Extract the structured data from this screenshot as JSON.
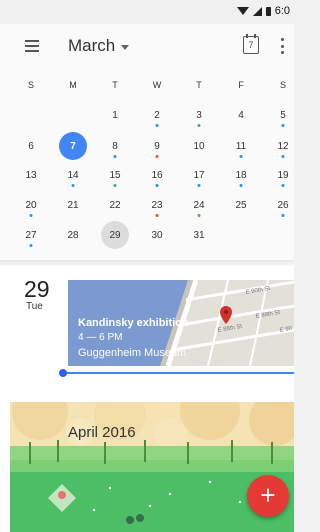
{
  "status_bar": {
    "time": "6:0"
  },
  "app_bar": {
    "month": "March",
    "today_icon_number": "7"
  },
  "calendar": {
    "weekdays": [
      "S",
      "M",
      "T",
      "W",
      "T",
      "F",
      "S"
    ],
    "weeks": [
      [
        "",
        "",
        "1",
        "2",
        "3",
        "4",
        "5"
      ],
      [
        "6",
        "7",
        "8",
        "9",
        "10",
        "11",
        "12"
      ],
      [
        "13",
        "14",
        "15",
        "16",
        "17",
        "18",
        "19"
      ],
      [
        "20",
        "21",
        "22",
        "23",
        "24",
        "25",
        "26"
      ],
      [
        "27",
        "28",
        "29",
        "30",
        "31",
        "",
        ""
      ]
    ],
    "today": "7",
    "selected": "29"
  },
  "agenda": {
    "date_number": "29",
    "date_weekday": "Tue",
    "event": {
      "title": "Kandinsky exhibition",
      "time": "4 — 6 PM",
      "location": "Guggenheim Museum",
      "map_streets": [
        "E 90th St",
        "E 89th St",
        "E 88th St",
        "E 90"
      ]
    }
  },
  "month_banner": {
    "title": "April 2016"
  },
  "fab": {
    "label": "+"
  },
  "colors": {
    "accent": "#4285f4",
    "fab": "#e53935",
    "dot_blue": "#2196f3",
    "dot_green": "#4caf50",
    "dot_orange": "#f4511e"
  }
}
